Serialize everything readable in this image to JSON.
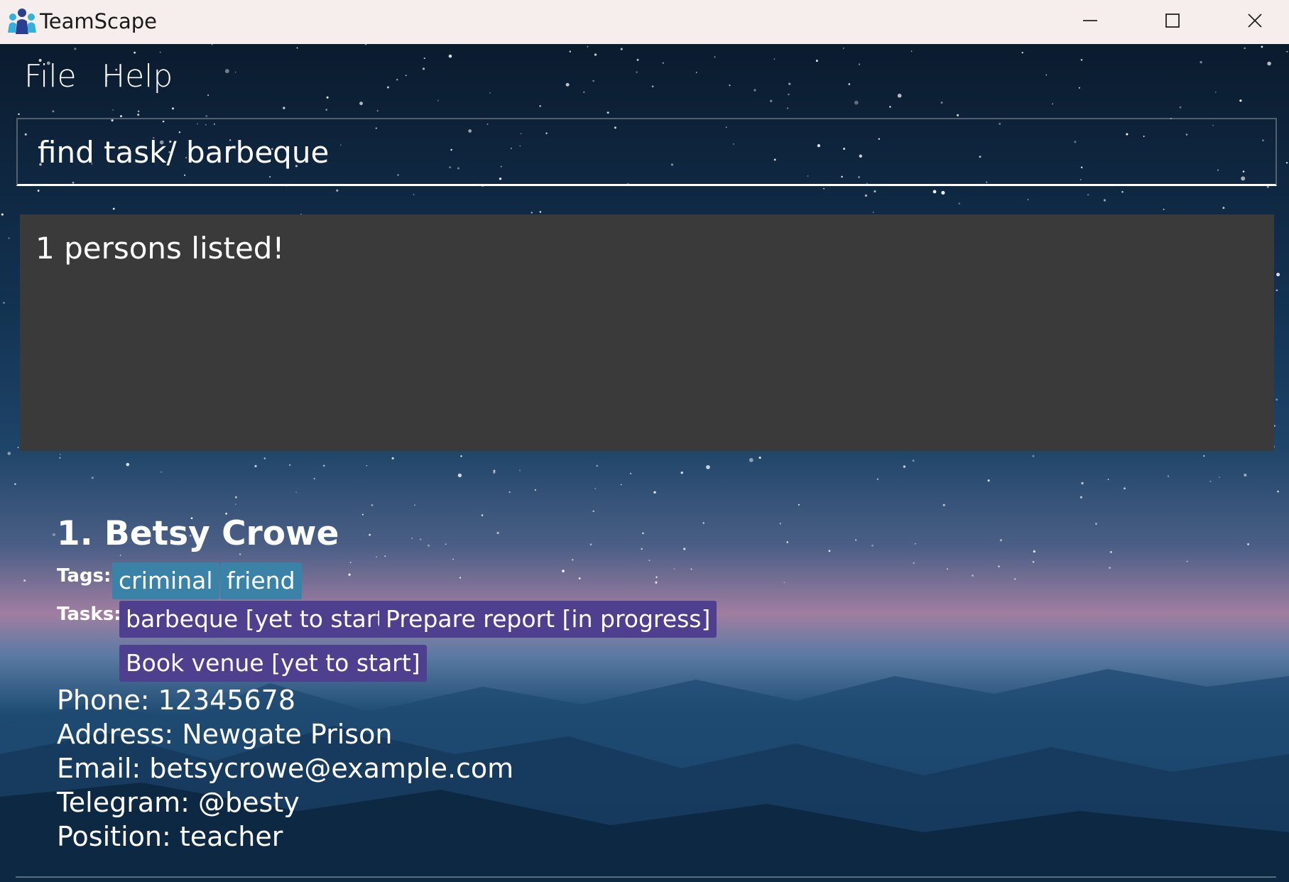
{
  "window": {
    "title": "TeamScape",
    "icon": "people-group-icon",
    "controls": {
      "minimize": "minimize-icon",
      "maximize": "maximize-icon",
      "close": "close-icon"
    }
  },
  "menu": {
    "items": [
      {
        "label": "File"
      },
      {
        "label": "Help"
      }
    ]
  },
  "command": {
    "value": "find task/ barbeque"
  },
  "result": {
    "message": "1 persons listed!"
  },
  "persons": [
    {
      "index_name": "1. Betsy Crowe",
      "tags_label": "Tags:",
      "tags": [
        "criminal",
        "friend"
      ],
      "tasks_label": "Tasks:",
      "tasks": [
        "barbeque [yet to start]",
        "Prepare report [in progress]",
        "Book venue [yet to start]"
      ],
      "phone": "Phone: 12345678",
      "address": "Address: Newgate Prison",
      "email": "Email: betsycrowe@example.com",
      "telegram": "Telegram: @besty",
      "position": "Position: teacher"
    }
  ],
  "colors": {
    "tag_bg": "#3a82a8",
    "task_bg": "#4f3f8f",
    "result_bg": "#3a3a3a",
    "titlebar_bg": "#f6eeec"
  }
}
